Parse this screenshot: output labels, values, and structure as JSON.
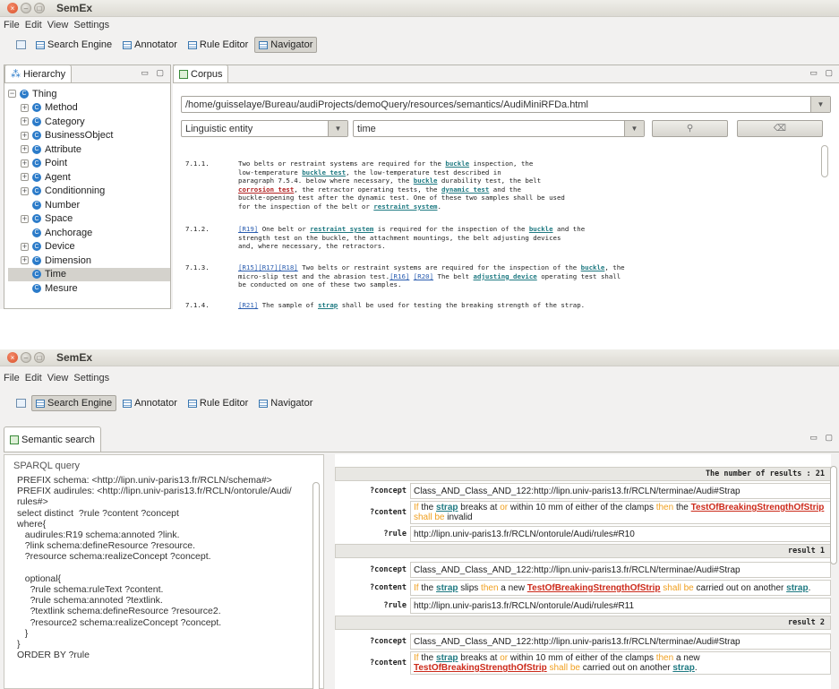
{
  "app_title": "SemEx",
  "menu": [
    "File",
    "Edit",
    "View",
    "Settings"
  ],
  "perspectives": [
    "Search Engine",
    "Annotator",
    "Rule Editor",
    "Navigator"
  ],
  "top": {
    "hierarchy_tab": "Hierarchy",
    "tree": [
      {
        "label": "Thing",
        "expander": "−"
      },
      {
        "label": "Method",
        "expander": "+"
      },
      {
        "label": "Category",
        "expander": "+"
      },
      {
        "label": "BusinessObject",
        "expander": "+"
      },
      {
        "label": "Attribute",
        "expander": "+"
      },
      {
        "label": "Point",
        "expander": "+"
      },
      {
        "label": "Agent",
        "expander": "+"
      },
      {
        "label": "Conditionning",
        "expander": "+"
      },
      {
        "label": "Number",
        "expander": ""
      },
      {
        "label": "Space",
        "expander": "+"
      },
      {
        "label": "Anchorage",
        "expander": ""
      },
      {
        "label": "Device",
        "expander": "+"
      },
      {
        "label": "Dimension",
        "expander": "+"
      },
      {
        "label": "Time",
        "expander": "",
        "selected": true
      },
      {
        "label": "Mesure",
        "expander": ""
      }
    ],
    "corpus_tab": "Corpus",
    "file_path": "/home/guisselaye/Bureau/audiProjects/demoQuery/resources/semantics/AudiMiniRFDa.html",
    "entity_type": "Linguistic entity",
    "entity_value": "time",
    "paragraphs": [
      {
        "num": "7.1.1.",
        "segments": [
          {
            "t": "Two belts or restraint systems are required for the "
          },
          {
            "t": "buckle",
            "c": "lk"
          },
          {
            "t": " inspection, the\nlow-temperature "
          },
          {
            "t": "buckle test",
            "c": "lk"
          },
          {
            "t": ", the low-temperature test described in\nparagraph 7.5.4. below where necessary, the "
          },
          {
            "t": "buckle",
            "c": "lk"
          },
          {
            "t": " durability test, the belt\n"
          },
          {
            "t": "corrosion test",
            "c": "lkr"
          },
          {
            "t": ", the retractor operating tests, the "
          },
          {
            "t": "dynamic test",
            "c": "lk"
          },
          {
            "t": " and the\nbuckle-opening test after the dynamic test. One of these two samples shall be used\nfor the inspection of the belt or "
          },
          {
            "t": "restraint system",
            "c": "lk"
          },
          {
            "t": "."
          }
        ]
      },
      {
        "num": "7.1.2.",
        "segments": [
          {
            "t": "[R19]",
            "c": "lkb"
          },
          {
            "t": " One belt or "
          },
          {
            "t": "restraint system",
            "c": "lk"
          },
          {
            "t": " is required for the inspection of the "
          },
          {
            "t": "buckle",
            "c": "lk"
          },
          {
            "t": " and the\nstrength test on the buckle, the attachment mountings, the belt adjusting devices\nand, where necessary, the retractors."
          }
        ]
      },
      {
        "num": "7.1.3.",
        "segments": [
          {
            "t": "[R15]",
            "c": "lkb"
          },
          {
            "t": "[R17]",
            "c": "lkb"
          },
          {
            "t": "[R18]",
            "c": "lkb"
          },
          {
            "t": " Two belts or restraint systems are required for the inspection of the "
          },
          {
            "t": "buckle",
            "c": "lk"
          },
          {
            "t": ", the\nmicro-slip test and the abrasion test."
          },
          {
            "t": "[R16]",
            "c": "lkb"
          },
          {
            "t": " "
          },
          {
            "t": "[R20]",
            "c": "lkb"
          },
          {
            "t": " The belt "
          },
          {
            "t": "adjusting device",
            "c": "lk"
          },
          {
            "t": " operating test shall\nbe conducted on one of these two samples."
          }
        ]
      },
      {
        "num": "7.1.4.",
        "segments": [
          {
            "t": "[R21]",
            "c": "lkb"
          },
          {
            "t": " The sample of "
          },
          {
            "t": "strap",
            "c": "lk"
          },
          {
            "t": " shall be used for testing the breaking strength of the strap."
          }
        ]
      }
    ]
  },
  "bottom": {
    "semantic_tab": "Semantic search",
    "sparql_legend": "SPARQL query",
    "sparql": "PREFIX schema: <http://lipn.univ-paris13.fr/RCLN/schema#>\nPREFIX audirules: <http://lipn.univ-paris13.fr/RCLN/ontorule/Audi/\nrules#>\nselect distinct  ?rule ?content ?concept\nwhere{\n   audirules:R19 schema:annoted ?link.\n   ?link schema:defineResource ?resource.\n   ?resource schema:realizeConcept ?concept.\n\n   optional{\n     ?rule schema:ruleText ?content.\n     ?rule schema:annoted ?textlink.\n     ?textlink schema:defineResource ?resource2.\n     ?resource2 schema:realizeConcept ?concept.\n   }\n}\nORDER BY ?rule",
    "results_header": "The number of results : 21",
    "results": [
      {
        "concept": "Class_AND_Class_AND_122:http://lipn.univ-paris13.fr/RCLN/terminae/Audi#Strap",
        "content": [
          {
            "t": "If",
            "c": "kw"
          },
          {
            "t": " the "
          },
          {
            "t": "strap",
            "c": "slink"
          },
          {
            "t": " breaks at "
          },
          {
            "t": "or",
            "c": "kw"
          },
          {
            "t": " within 10 mm of either of the clamps "
          },
          {
            "t": "then",
            "c": "kw"
          },
          {
            "t": " the "
          },
          {
            "t": "TestOfBreakingStrengthOfStrip",
            "c": "rlink"
          },
          {
            "t": "\n"
          },
          {
            "t": "shall be",
            "c": "kw"
          },
          {
            "t": " invalid"
          }
        ],
        "rule": "http://lipn.univ-paris13.fr/RCLN/ontorule/Audi/rules#R10",
        "label": "result 1"
      },
      {
        "concept": "Class_AND_Class_AND_122:http://lipn.univ-paris13.fr/RCLN/terminae/Audi#Strap",
        "content": [
          {
            "t": "If",
            "c": "kw"
          },
          {
            "t": " the "
          },
          {
            "t": "strap",
            "c": "slink"
          },
          {
            "t": " slips "
          },
          {
            "t": "then",
            "c": "kw"
          },
          {
            "t": " a new "
          },
          {
            "t": "TestOfBreakingStrengthOfStrip",
            "c": "rlink"
          },
          {
            "t": " "
          },
          {
            "t": "shall be",
            "c": "kw"
          },
          {
            "t": " carried out on another "
          },
          {
            "t": "strap",
            "c": "slink"
          },
          {
            "t": "."
          }
        ],
        "rule": "http://lipn.univ-paris13.fr/RCLN/ontorule/Audi/rules#R11",
        "label": "result 2"
      },
      {
        "concept": "Class_AND_Class_AND_122:http://lipn.univ-paris13.fr/RCLN/terminae/Audi#Strap",
        "content": [
          {
            "t": "If",
            "c": "kw"
          },
          {
            "t": " the "
          },
          {
            "t": "strap",
            "c": "slink"
          },
          {
            "t": " breaks at "
          },
          {
            "t": "or",
            "c": "kw"
          },
          {
            "t": " within 10 mm of either of the clamps "
          },
          {
            "t": "then",
            "c": "kw"
          },
          {
            "t": " a new\n"
          },
          {
            "t": "TestOfBreakingStrengthOfStrip",
            "c": "rlink"
          },
          {
            "t": " "
          },
          {
            "t": "shall be",
            "c": "kw"
          },
          {
            "t": " carried out on another "
          },
          {
            "t": "strap",
            "c": "slink"
          },
          {
            "t": "."
          }
        ]
      }
    ],
    "keys": {
      "concept": "?concept",
      "content": "?content",
      "rule": "?rule"
    }
  },
  "colors": {
    "accent": "#2b7bc9",
    "keyword": "#f0a020",
    "rule_link": "#cc2a1a",
    "term_link": "#1f7a82"
  }
}
